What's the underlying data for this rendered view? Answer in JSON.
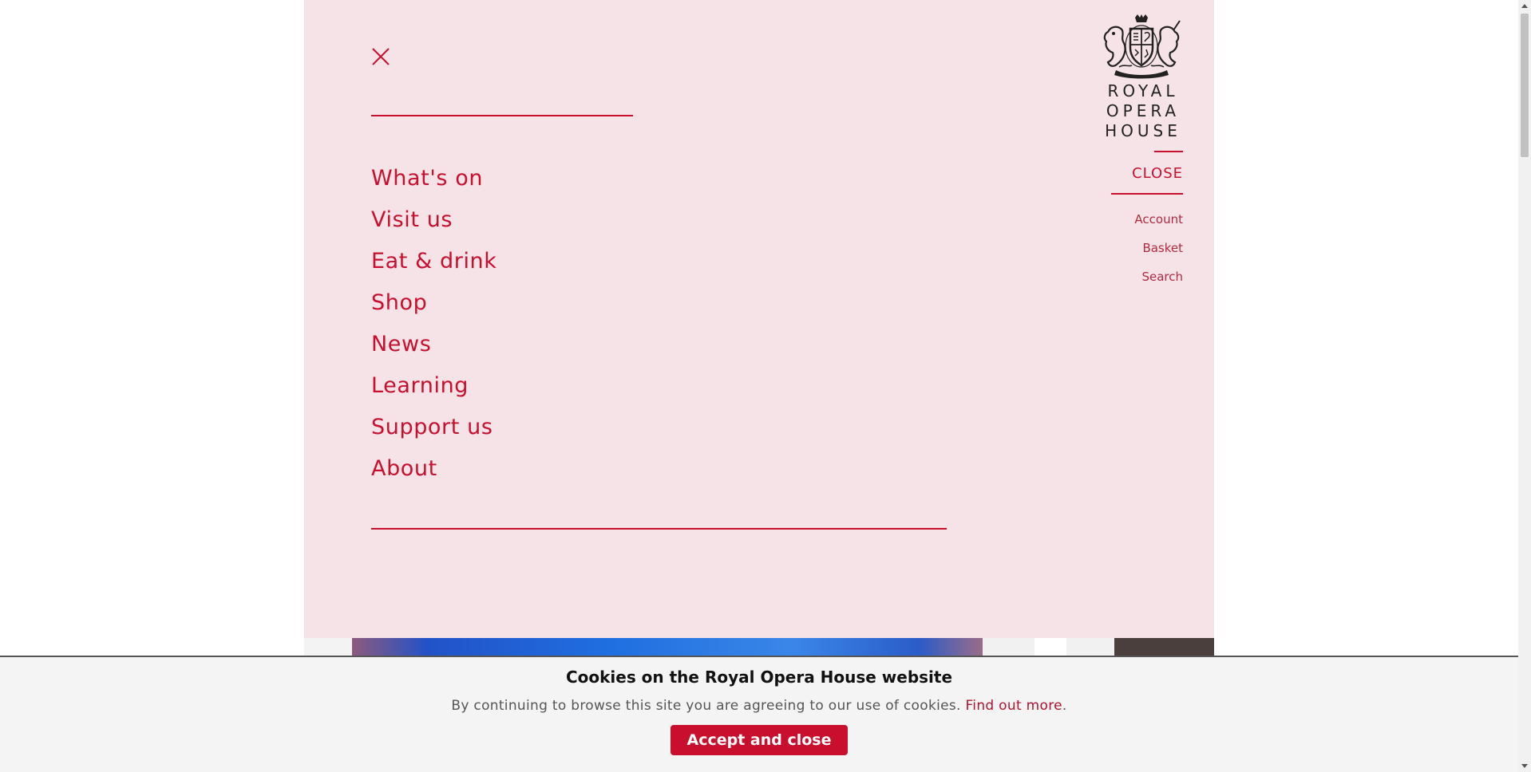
{
  "menu": {
    "items": [
      {
        "label": "What's on"
      },
      {
        "label": "Visit us"
      },
      {
        "label": "Eat & drink"
      },
      {
        "label": "Shop"
      },
      {
        "label": "News"
      },
      {
        "label": "Learning"
      },
      {
        "label": "Support us"
      },
      {
        "label": "About"
      }
    ],
    "close_icon": "close-x-icon"
  },
  "logo": {
    "line1": "ROYAL",
    "line2": "OPERA",
    "line3": "HOUSE",
    "icon": "royal-crest-icon"
  },
  "header": {
    "close_label": "CLOSE",
    "links": {
      "account": "Account",
      "basket": "Basket",
      "search": "Search"
    }
  },
  "cookie": {
    "title": "Cookies on the Royal Opera House website",
    "text": "By continuing to browse this site you are agreeing to our use of cookies.",
    "link": "Find out more",
    "period": ".",
    "button": "Accept and close"
  },
  "colors": {
    "accent": "#c8102e",
    "panel_bg": "#f6e3e7",
    "banner_bg": "#f4f4f4"
  }
}
